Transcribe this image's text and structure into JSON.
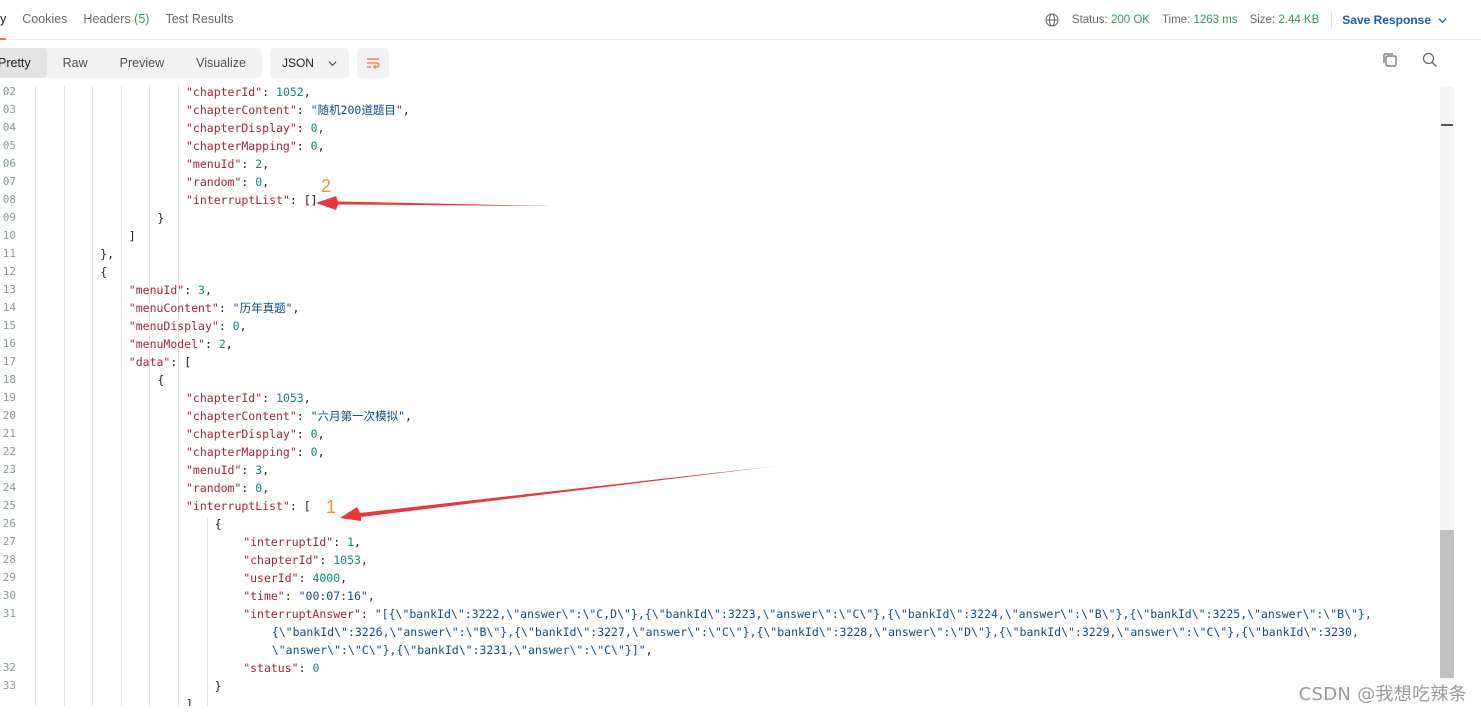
{
  "tabs": [
    {
      "label": "y",
      "count": ""
    },
    {
      "label": "Cookies",
      "count": ""
    },
    {
      "label": "Headers",
      "count": "(5)"
    },
    {
      "label": "Test Results",
      "count": ""
    }
  ],
  "status_bar": {
    "status_label": "Status:",
    "status_value": "200 OK",
    "time_label": "Time:",
    "time_value": "1263 ms",
    "size_label": "Size:",
    "size_value": "2.44 KB",
    "save_response": "Save Response"
  },
  "toolbar": {
    "view_modes": [
      "Pretty",
      "Raw",
      "Preview",
      "Visualize"
    ],
    "active_view": "Pretty",
    "format": "JSON"
  },
  "code_lines": [
    {
      "n": "02",
      "indent": 6,
      "tokens": [
        [
          "k",
          "\"chapterId\""
        ],
        [
          "p",
          ": "
        ],
        [
          "n",
          "1052"
        ],
        [
          "p",
          ","
        ]
      ]
    },
    {
      "n": "03",
      "indent": 6,
      "tokens": [
        [
          "k",
          "\"chapterContent\""
        ],
        [
          "p",
          ": "
        ],
        [
          "s",
          "\"随机200道题目\""
        ],
        [
          "p",
          ","
        ]
      ]
    },
    {
      "n": "04",
      "indent": 6,
      "tokens": [
        [
          "k",
          "\"chapterDisplay\""
        ],
        [
          "p",
          ": "
        ],
        [
          "n",
          "0"
        ],
        [
          "p",
          ","
        ]
      ]
    },
    {
      "n": "05",
      "indent": 6,
      "tokens": [
        [
          "k",
          "\"chapterMapping\""
        ],
        [
          "p",
          ": "
        ],
        [
          "n",
          "0"
        ],
        [
          "p",
          ","
        ]
      ]
    },
    {
      "n": "06",
      "indent": 6,
      "tokens": [
        [
          "k",
          "\"menuId\""
        ],
        [
          "p",
          ": "
        ],
        [
          "n",
          "2"
        ],
        [
          "p",
          ","
        ]
      ]
    },
    {
      "n": "07",
      "indent": 6,
      "tokens": [
        [
          "k",
          "\"random\""
        ],
        [
          "p",
          ": "
        ],
        [
          "n",
          "0"
        ],
        [
          "p",
          ","
        ]
      ]
    },
    {
      "n": "08",
      "indent": 6,
      "tokens": [
        [
          "k",
          "\"interruptList\""
        ],
        [
          "p",
          ": []"
        ]
      ]
    },
    {
      "n": "09",
      "indent": 5,
      "tokens": [
        [
          "p",
          "}"
        ]
      ]
    },
    {
      "n": "10",
      "indent": 4,
      "tokens": [
        [
          "p",
          "]"
        ]
      ]
    },
    {
      "n": "11",
      "indent": 3,
      "tokens": [
        [
          "p",
          "},"
        ]
      ]
    },
    {
      "n": "12",
      "indent": 3,
      "tokens": [
        [
          "p",
          "{"
        ]
      ]
    },
    {
      "n": "13",
      "indent": 4,
      "tokens": [
        [
          "k",
          "\"menuId\""
        ],
        [
          "p",
          ": "
        ],
        [
          "n",
          "3"
        ],
        [
          "p",
          ","
        ]
      ]
    },
    {
      "n": "14",
      "indent": 4,
      "tokens": [
        [
          "k",
          "\"menuContent\""
        ],
        [
          "p",
          ": "
        ],
        [
          "s",
          "\"历年真题\""
        ],
        [
          "p",
          ","
        ]
      ]
    },
    {
      "n": "15",
      "indent": 4,
      "tokens": [
        [
          "k",
          "\"menuDisplay\""
        ],
        [
          "p",
          ": "
        ],
        [
          "n",
          "0"
        ],
        [
          "p",
          ","
        ]
      ]
    },
    {
      "n": "16",
      "indent": 4,
      "tokens": [
        [
          "k",
          "\"menuModel\""
        ],
        [
          "p",
          ": "
        ],
        [
          "n",
          "2"
        ],
        [
          "p",
          ","
        ]
      ]
    },
    {
      "n": "17",
      "indent": 4,
      "tokens": [
        [
          "k",
          "\"data\""
        ],
        [
          "p",
          ": ["
        ]
      ]
    },
    {
      "n": "18",
      "indent": 5,
      "tokens": [
        [
          "p",
          "{"
        ]
      ]
    },
    {
      "n": "19",
      "indent": 6,
      "tokens": [
        [
          "k",
          "\"chapterId\""
        ],
        [
          "p",
          ": "
        ],
        [
          "n",
          "1053"
        ],
        [
          "p",
          ","
        ]
      ]
    },
    {
      "n": "20",
      "indent": 6,
      "tokens": [
        [
          "k",
          "\"chapterContent\""
        ],
        [
          "p",
          ": "
        ],
        [
          "s",
          "\"六月第一次模拟\""
        ],
        [
          "p",
          ","
        ]
      ]
    },
    {
      "n": "21",
      "indent": 6,
      "tokens": [
        [
          "k",
          "\"chapterDisplay\""
        ],
        [
          "p",
          ": "
        ],
        [
          "n",
          "0"
        ],
        [
          "p",
          ","
        ]
      ]
    },
    {
      "n": "22",
      "indent": 6,
      "tokens": [
        [
          "k",
          "\"chapterMapping\""
        ],
        [
          "p",
          ": "
        ],
        [
          "n",
          "0"
        ],
        [
          "p",
          ","
        ]
      ]
    },
    {
      "n": "23",
      "indent": 6,
      "tokens": [
        [
          "k",
          "\"menuId\""
        ],
        [
          "p",
          ": "
        ],
        [
          "n",
          "3"
        ],
        [
          "p",
          ","
        ]
      ]
    },
    {
      "n": "24",
      "indent": 6,
      "tokens": [
        [
          "k",
          "\"random\""
        ],
        [
          "p",
          ": "
        ],
        [
          "n",
          "0"
        ],
        [
          "p",
          ","
        ]
      ]
    },
    {
      "n": "25",
      "indent": 6,
      "tokens": [
        [
          "k",
          "\"interruptList\""
        ],
        [
          "p",
          ": ["
        ]
      ]
    },
    {
      "n": "26",
      "indent": 7,
      "tokens": [
        [
          "p",
          "{"
        ]
      ]
    },
    {
      "n": "27",
      "indent": 8,
      "tokens": [
        [
          "k",
          "\"interruptId\""
        ],
        [
          "p",
          ": "
        ],
        [
          "n",
          "1"
        ],
        [
          "p",
          ","
        ]
      ]
    },
    {
      "n": "28",
      "indent": 8,
      "tokens": [
        [
          "k",
          "\"chapterId\""
        ],
        [
          "p",
          ": "
        ],
        [
          "n",
          "1053"
        ],
        [
          "p",
          ","
        ]
      ]
    },
    {
      "n": "29",
      "indent": 8,
      "tokens": [
        [
          "k",
          "\"userId\""
        ],
        [
          "p",
          ": "
        ],
        [
          "n",
          "4000"
        ],
        [
          "p",
          ","
        ]
      ]
    },
    {
      "n": "30",
      "indent": 8,
      "tokens": [
        [
          "k",
          "\"time\""
        ],
        [
          "p",
          ": "
        ],
        [
          "s",
          "\"00:07:16\""
        ],
        [
          "p",
          ","
        ]
      ]
    },
    {
      "n": "31",
      "indent": 8,
      "tokens": [
        [
          "k",
          "\"interruptAnswer\""
        ],
        [
          "p",
          ": "
        ],
        [
          "s",
          "\"[{\\\"bankId\\\":3222,\\\"answer\\\":\\\"C,D\\\"},{\\\"bankId\\\":3223,\\\"answer\\\":\\\"C\\\"},{\\\"bankId\\\":3224,\\\"answer\\\":\\\"B\\\"},{\\\"bankId\\\":3225,\\\"answer\\\":\\\"B\\\"},"
        ]
      ]
    },
    {
      "n": "",
      "indent": 9,
      "tokens": [
        [
          "s",
          "{\\\"bankId\\\":3226,\\\"answer\\\":\\\"B\\\"},{\\\"bankId\\\":3227,\\\"answer\\\":\\\"C\\\"},{\\\"bankId\\\":3228,\\\"answer\\\":\\\"D\\\"},{\\\"bankId\\\":3229,\\\"answer\\\":\\\"C\\\"},{\\\"bankId\\\":3230,"
        ]
      ]
    },
    {
      "n": "",
      "indent": 9,
      "tokens": [
        [
          "s",
          "\\\"answer\\\":\\\"C\\\"},{\\\"bankId\\\":3231,\\\"answer\\\":\\\"C\\\"}]\""
        ],
        [
          "p",
          ","
        ]
      ]
    },
    {
      "n": "32",
      "indent": 8,
      "tokens": [
        [
          "k",
          "\"status\""
        ],
        [
          "p",
          ": "
        ],
        [
          "n",
          "0"
        ]
      ]
    },
    {
      "n": "33",
      "indent": 7,
      "tokens": [
        [
          "p",
          "}"
        ]
      ]
    },
    {
      "n": "",
      "indent": 6,
      "tokens": [
        [
          "p",
          "]"
        ]
      ]
    }
  ],
  "annotations": {
    "label_1": "1",
    "label_2": "2"
  },
  "watermark": "CSDN @我想吃辣条",
  "colors": {
    "accent": "#ff6c37",
    "status_ok": "#2e9e5b",
    "link": "#1c5eb5",
    "key": "#a3253d",
    "string": "#0f4d8a",
    "number": "#13877a",
    "arrow": "#e8383d",
    "annotation_text": "#ff8a3d"
  }
}
